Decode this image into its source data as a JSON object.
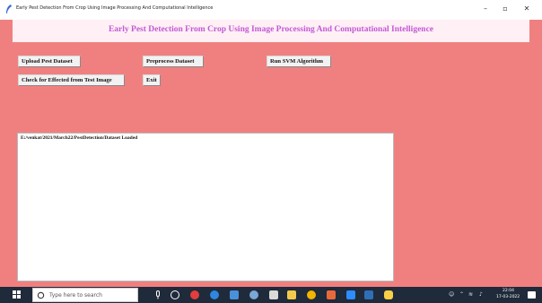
{
  "window": {
    "title": "Early Pest Detection From Crop Using Image Processing And Computational Intelligence",
    "minimize_glyph": "–",
    "maximize_glyph": "▫",
    "close_glyph": "✕"
  },
  "app": {
    "heading": "Early Pest Detection From Crop Using Image Processing And Computational Intelligence"
  },
  "buttons": {
    "upload": "Upload Pest Dataset",
    "preprocess": "Preprocess Dataset",
    "svm": "Run SVM Algorithm",
    "check": "Check for Effected from Test Image",
    "exit": "Exit"
  },
  "output": {
    "text": "E:/venkat/2021/March22/PestDetection/Dataset Loaded"
  },
  "taskbar": {
    "search_placeholder": "Type here to search",
    "time": "22:04",
    "date": "17-03-2022",
    "icons": [
      "mic-icon",
      "task-view-icon",
      "opera-icon",
      "edge-icon",
      "store-icon",
      "settings-icon",
      "notes-icon",
      "files-icon",
      "chrome-icon",
      "paint-icon",
      "mail-icon",
      "photos-icon",
      "python-icon"
    ]
  },
  "colors": {
    "background": "#f08080",
    "heading_band": "#fff0f5",
    "heading_text": "#c05ad6",
    "taskbar": "#1f2a3a"
  }
}
